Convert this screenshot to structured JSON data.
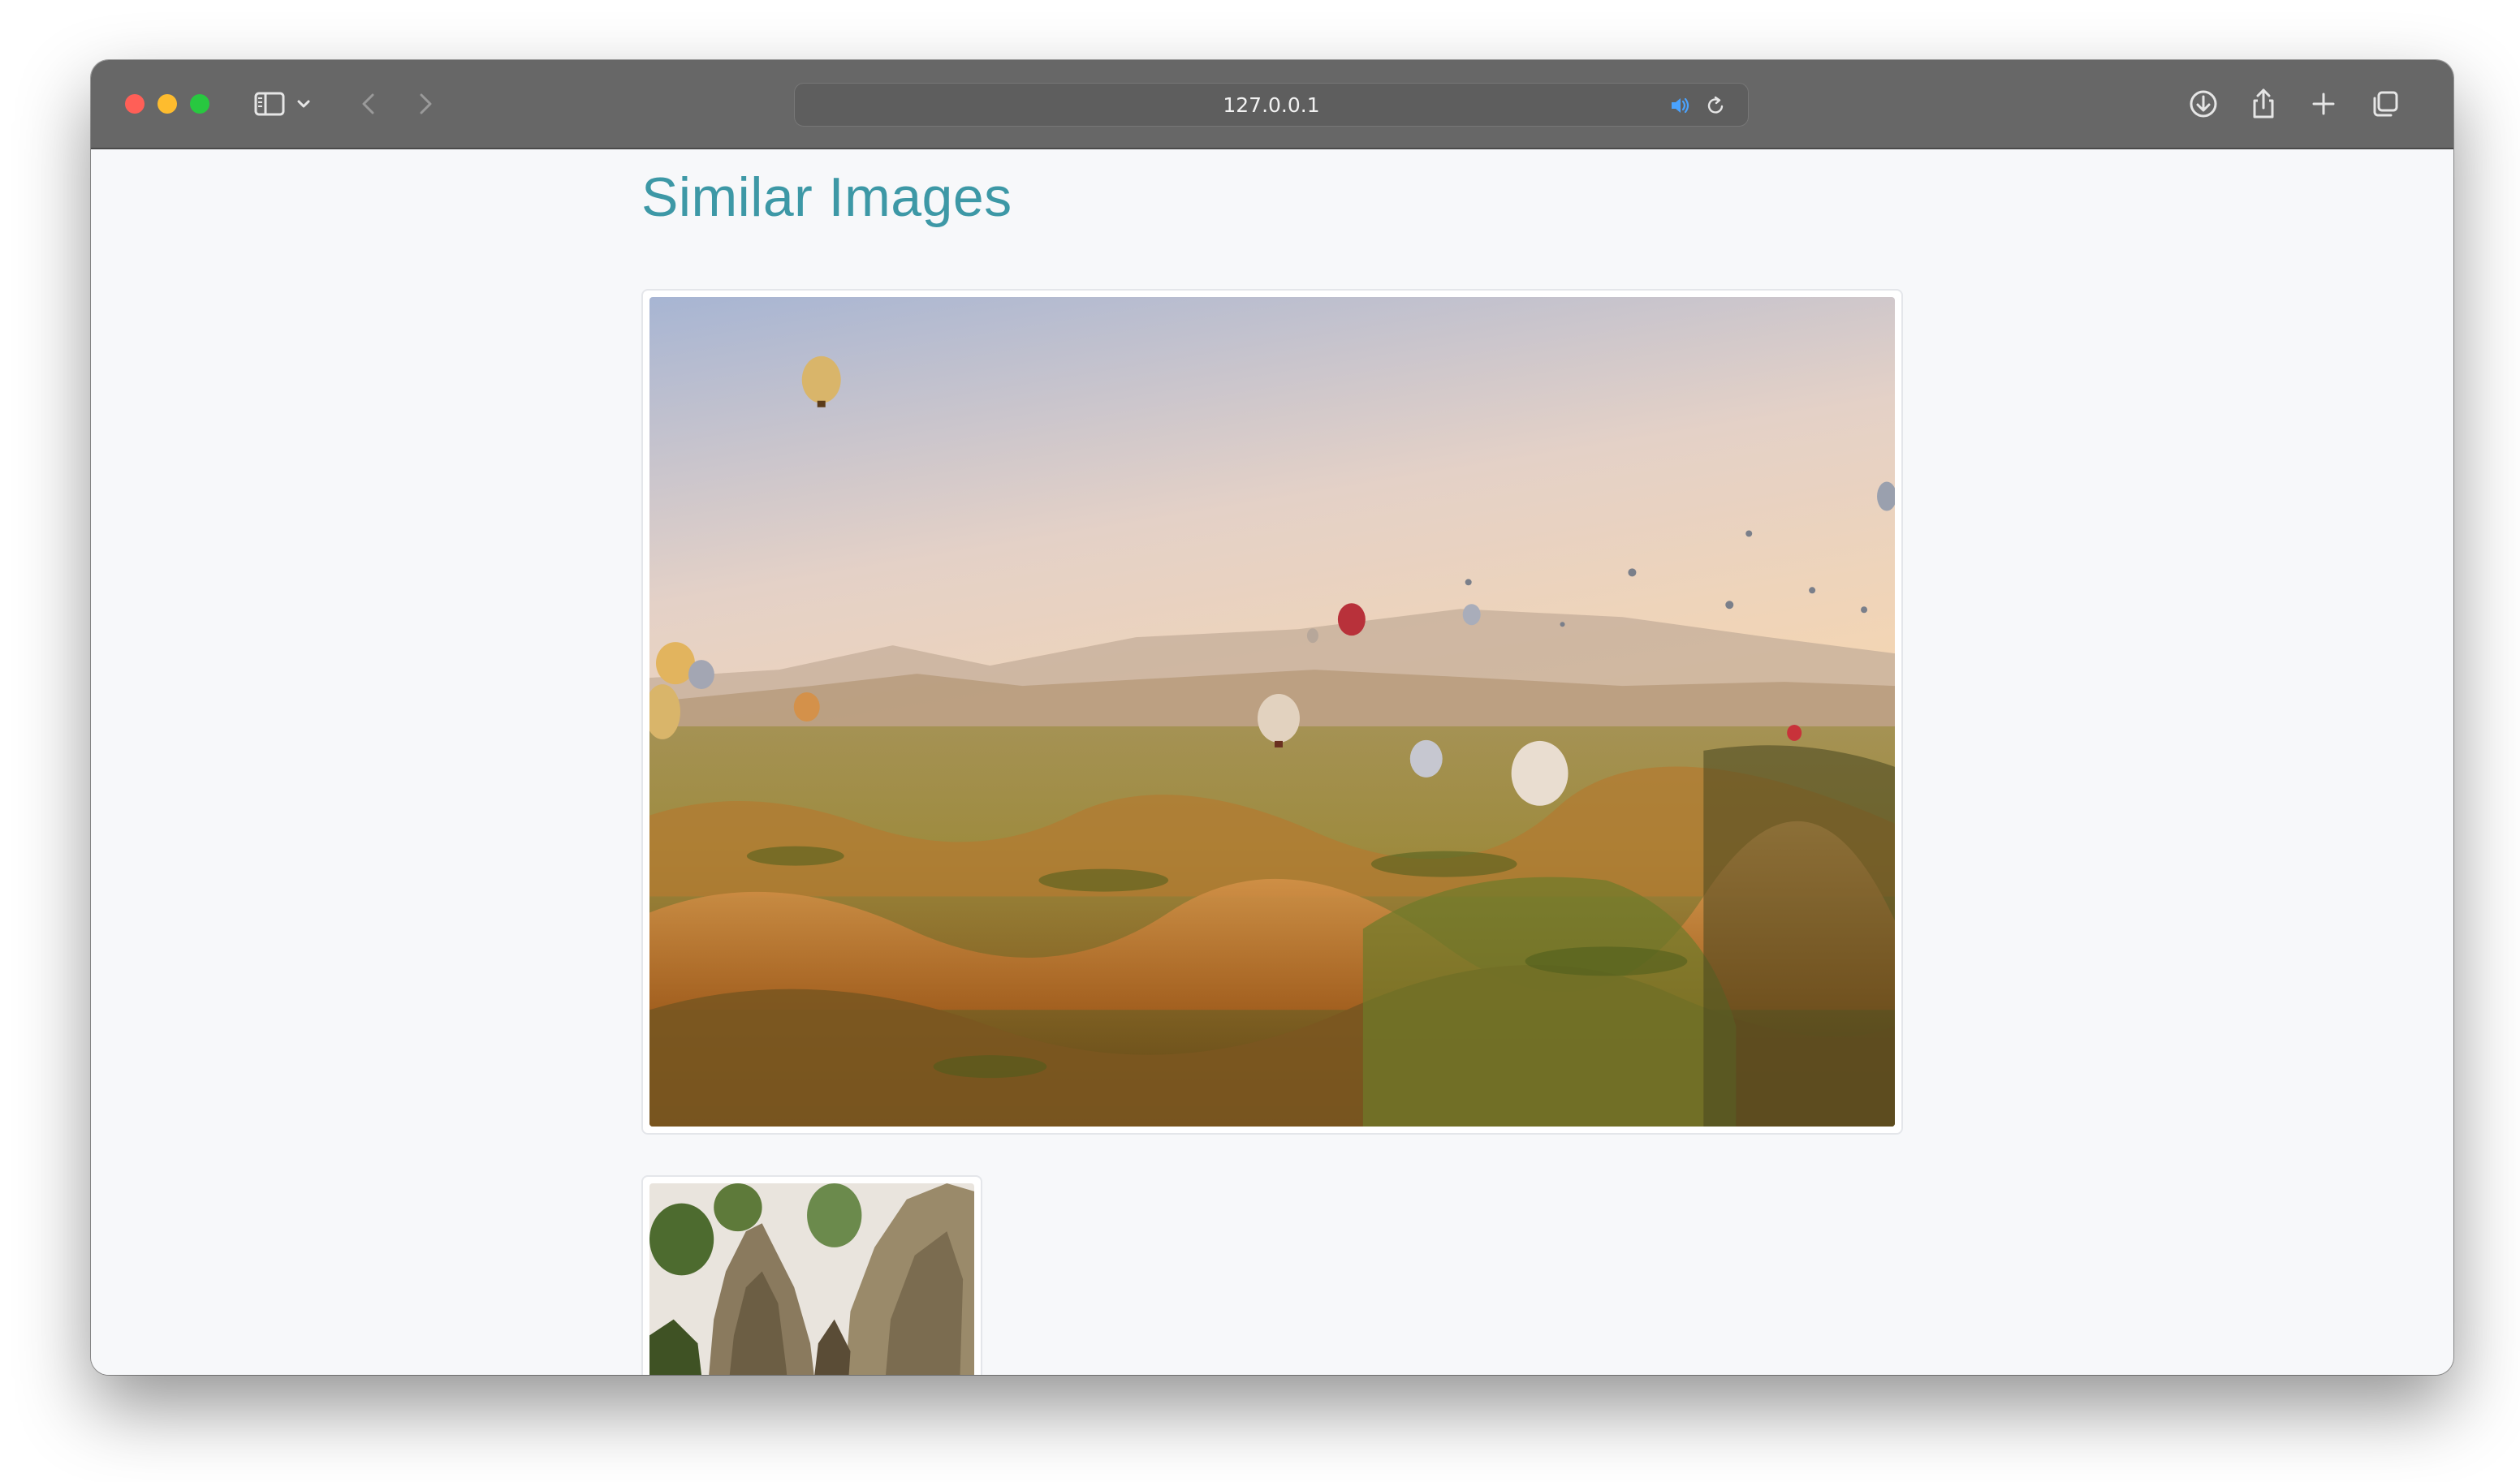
{
  "browser": {
    "url": "127.0.0.1",
    "icons": {
      "sidebar": "sidebar-icon",
      "chevron": "chevron-down-icon",
      "back": "back-arrow-icon",
      "forward": "forward-arrow-icon",
      "audio": "speaker-icon",
      "reload": "reload-icon",
      "download": "download-icon",
      "share": "share-icon",
      "new_tab": "plus-icon",
      "tabs": "tab-overview-icon"
    },
    "colors": {
      "toolbar": "#676767",
      "audio_accent": "#4aa3ff"
    }
  },
  "page": {
    "title": "Similar Images",
    "title_color": "#3d98a6",
    "images": [
      {
        "kind": "main-image",
        "subject": "hot air balloons over valley landscape at sunrise"
      },
      {
        "kind": "thumbnail",
        "subject": "rock formations with trees"
      }
    ]
  }
}
